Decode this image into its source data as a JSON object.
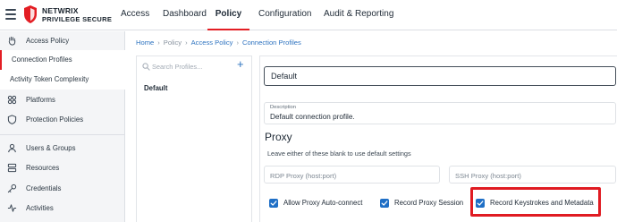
{
  "brand": {
    "line1": "NETWRIX",
    "line2": "PRIVILEGE SECURE"
  },
  "nav": {
    "items": [
      {
        "label": "Access"
      },
      {
        "label": "Dashboard"
      },
      {
        "label": "Policy",
        "active": true
      },
      {
        "label": "Configuration"
      },
      {
        "label": "Audit & Reporting"
      }
    ],
    "accent_color": "#e31e24"
  },
  "sidebar": {
    "items": [
      {
        "label": "Access Policy",
        "icon": "hand-icon"
      },
      {
        "label": "Connection Profiles",
        "active": true
      },
      {
        "label": "Activity Token Complexity"
      },
      {
        "label": "Platforms",
        "icon": "platforms-icon"
      },
      {
        "label": "Protection Policies",
        "icon": "shield-icon"
      },
      {
        "label": "Users & Groups",
        "icon": "user-icon"
      },
      {
        "label": "Resources",
        "icon": "server-icon"
      },
      {
        "label": "Credentials",
        "icon": "key-icon"
      },
      {
        "label": "Activities",
        "icon": "activity-icon"
      }
    ]
  },
  "breadcrumb": [
    "Home",
    "Policy",
    "Access Policy",
    "Connection Profiles"
  ],
  "profiles": {
    "search_placeholder": "Search Profiles...",
    "add_label": "+",
    "items": [
      "Default"
    ]
  },
  "details": {
    "name": "Default",
    "description_label": "Description",
    "description": "Default connection profile.",
    "section_title": "Proxy",
    "hint": "Leave either of these blank to use default settings",
    "rdp_placeholder": "RDP Proxy (host:port)",
    "ssh_placeholder": "SSH Proxy (host:port)",
    "checkboxes": [
      {
        "label": "Allow Proxy Auto-connect",
        "checked": true
      },
      {
        "label": "Record Proxy Session",
        "checked": true
      },
      {
        "label": "Record Keystrokes and Metadata",
        "checked": true
      }
    ],
    "checkbox_color": "#1f6fc6",
    "highlight_color": "#e01b22"
  }
}
